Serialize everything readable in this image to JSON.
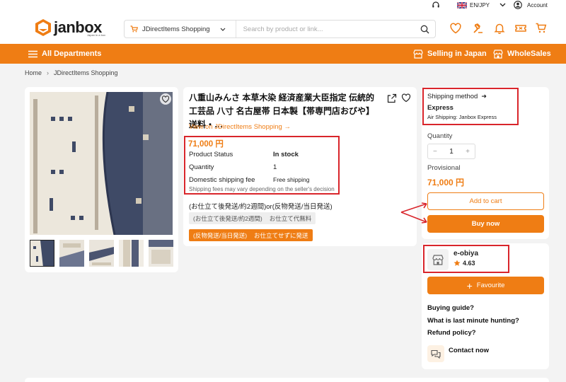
{
  "header": {
    "language": "EN/JPY",
    "account": "Account",
    "logo_text": "janbox",
    "logo_tagline": "Japan in a box",
    "search_scope": "JDirectItems Shopping",
    "search_placeholder": "Search by product or link..."
  },
  "nav": {
    "departments": "All Departments",
    "selling": "Selling in Japan",
    "wholesales": "WholeSales"
  },
  "breadcrumb": {
    "home": "Home",
    "current": "JDirectItems Shopping"
  },
  "product": {
    "title": "八重山みんさ 本草木染 経済産業大臣指定 伝統的工芸品 八寸 名古屋帯 日本製【帯専門店おびや】送料・…",
    "view_link": "View on JDirectItems Shopping →",
    "price": "71,000 円",
    "status_label": "Product Status",
    "status_value": "In stock",
    "quantity_label": "Quantity",
    "quantity_value": "1",
    "shipping_label": "Domestic shipping fee",
    "shipping_value": "Free shipping",
    "shipping_note": "Shipping fees may vary depending on the seller's decision",
    "variant_title": "(お仕立て後発送/約2週間)or(反物発送/当日発送)",
    "option1": "(お仕立て後発送/約2週間)",
    "option2": "お仕立て代無料",
    "option3": "(反物発送/当日発送)",
    "option4": "お仕立てせずに発送"
  },
  "purchase": {
    "shipping_method_label": "Shipping method",
    "shipping_method_arrow": "➜",
    "shipping_method": "Express",
    "air_shipping": "Air Shipping:  Janbox Express",
    "quantity_label": "Quantity",
    "qty_minus": "−",
    "qty_value": "1",
    "qty_plus": "+",
    "provisional_label": "Provisional",
    "provisional_price": "71,000 円",
    "add_to_cart": "Add to cart",
    "buy_now": "Buy now"
  },
  "seller": {
    "name": "e-obiya",
    "rating": "4.63",
    "favourite": "Favourite",
    "q1": "Buying guide?",
    "q2": "What is last minute hunting?",
    "q3": "Refund policy?",
    "contact": "Contact now"
  },
  "colors": {
    "accent": "#ef7d14",
    "highlight_box": "#d9252b",
    "fabric_navy": "#3f4a66",
    "fabric_cream": "#ece7dc"
  }
}
